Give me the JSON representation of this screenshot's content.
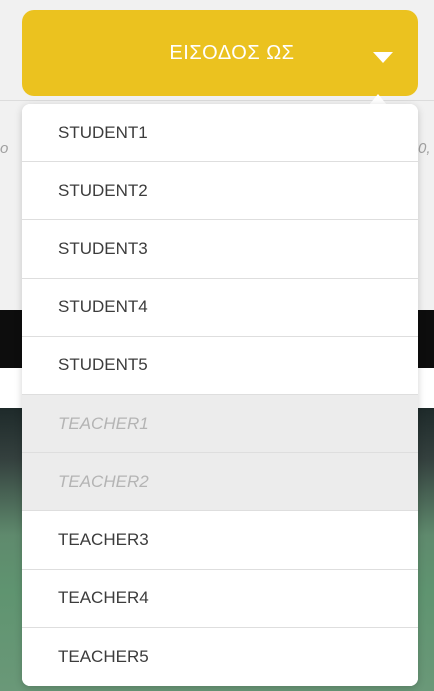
{
  "login": {
    "button_label": "ΕΙΣΟΔΟΣ ΩΣ"
  },
  "background_peek": {
    "left": "o",
    "right": "0,"
  },
  "dropdown": {
    "items": [
      {
        "label": "STUDENT1",
        "disabled": false
      },
      {
        "label": "STUDENT2",
        "disabled": false
      },
      {
        "label": "STUDENT3",
        "disabled": false
      },
      {
        "label": "STUDENT4",
        "disabled": false
      },
      {
        "label": "STUDENT5",
        "disabled": false
      },
      {
        "label": "TEACHER1",
        "disabled": true
      },
      {
        "label": "TEACHER2",
        "disabled": true
      },
      {
        "label": "TEACHER3",
        "disabled": false
      },
      {
        "label": "TEACHER4",
        "disabled": false
      },
      {
        "label": "TEACHER5",
        "disabled": false
      }
    ]
  },
  "colors": {
    "button": "#ebc21f",
    "disabled_item_bg": "#ececec",
    "item_text": "#3c3c3c"
  },
  "icons": {
    "caret": "caret-down-icon"
  }
}
